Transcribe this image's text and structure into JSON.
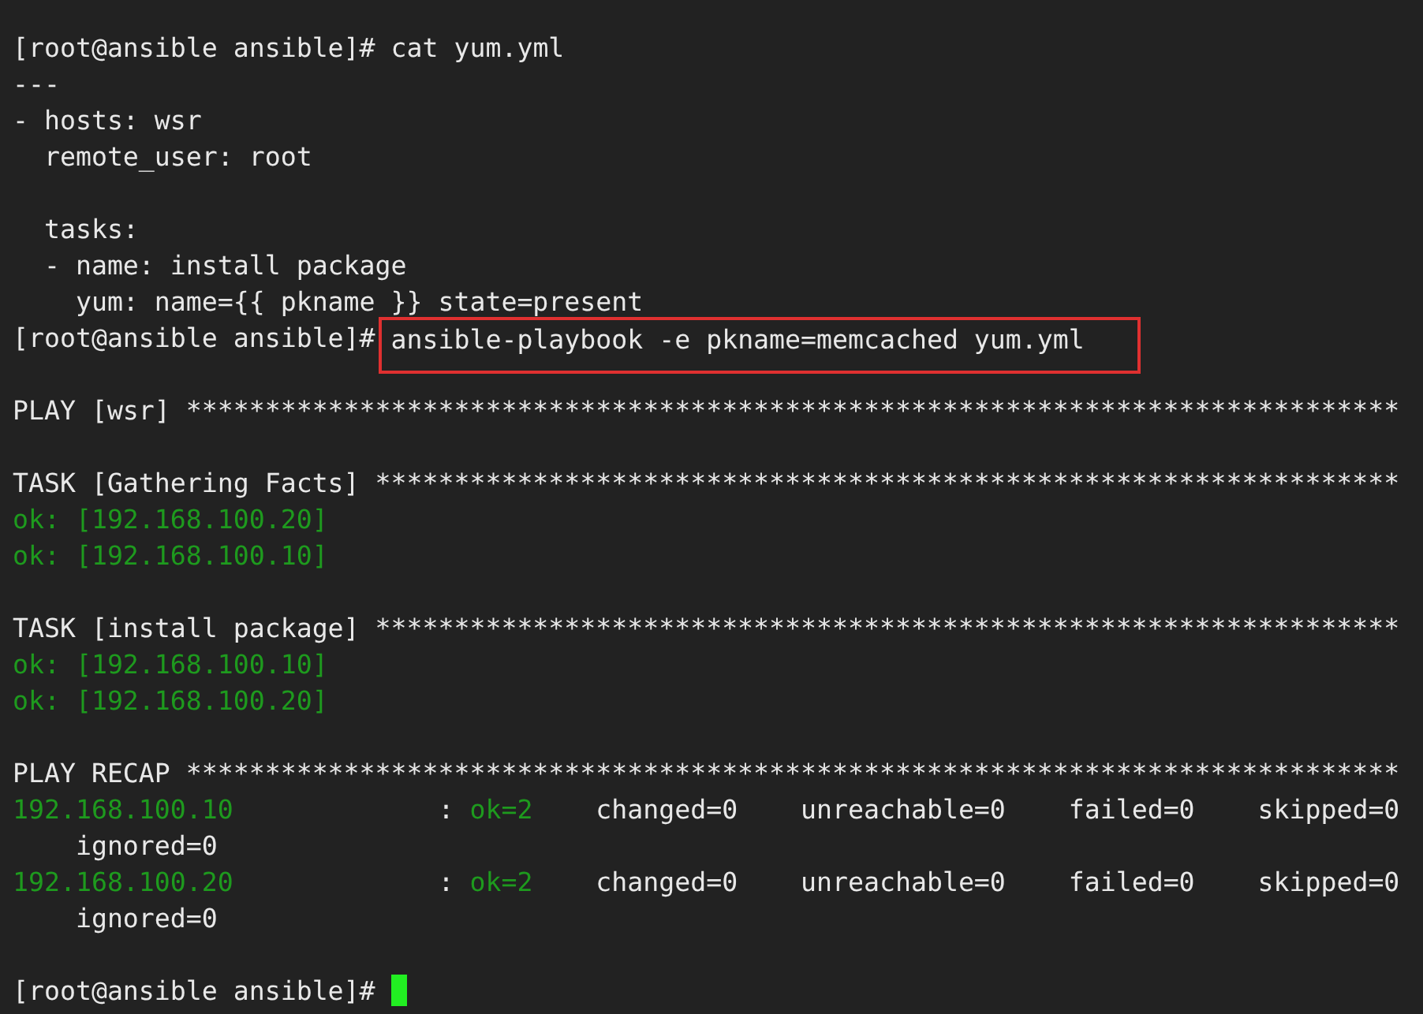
{
  "terminal": {
    "lines": [
      {
        "kind": "text",
        "segments": [
          {
            "kind": "prompt",
            "text": "[root@ansible ansible]# "
          },
          {
            "kind": "command",
            "text": "cat yum.yml",
            "highlighted": false
          }
        ]
      },
      {
        "kind": "text",
        "segments": [
          {
            "kind": "output",
            "text": "---"
          }
        ]
      },
      {
        "kind": "text",
        "segments": [
          {
            "kind": "output",
            "text": "- hosts: wsr"
          }
        ]
      },
      {
        "kind": "text",
        "segments": [
          {
            "kind": "output",
            "text": "  remote_user: root"
          }
        ]
      },
      {
        "kind": "blank"
      },
      {
        "kind": "text",
        "segments": [
          {
            "kind": "output",
            "text": "  tasks:"
          }
        ]
      },
      {
        "kind": "text",
        "segments": [
          {
            "kind": "output",
            "text": "  - name: install package"
          }
        ]
      },
      {
        "kind": "text",
        "segments": [
          {
            "kind": "output",
            "text": "    yum: name={{ pkname }} state=present"
          }
        ]
      },
      {
        "kind": "text",
        "segments": [
          {
            "kind": "prompt",
            "text": "[root@ansible ansible]# "
          },
          {
            "kind": "command",
            "text": "ansible-playbook -e pkname=memcached yum.yml",
            "highlighted": true
          }
        ]
      },
      {
        "kind": "blank"
      },
      {
        "kind": "text",
        "segments": [
          {
            "kind": "output",
            "text": "PLAY [wsr] *****************************************************************************"
          }
        ]
      },
      {
        "kind": "blank"
      },
      {
        "kind": "text",
        "segments": [
          {
            "kind": "output",
            "text": "TASK [Gathering Facts] *****************************************************************"
          }
        ]
      },
      {
        "kind": "text",
        "segments": [
          {
            "kind": "ok",
            "text": "ok: [192.168.100.20]"
          }
        ]
      },
      {
        "kind": "text",
        "segments": [
          {
            "kind": "ok",
            "text": "ok: [192.168.100.10]"
          }
        ]
      },
      {
        "kind": "blank"
      },
      {
        "kind": "text",
        "segments": [
          {
            "kind": "output",
            "text": "TASK [install package] *****************************************************************"
          }
        ]
      },
      {
        "kind": "text",
        "segments": [
          {
            "kind": "ok",
            "text": "ok: [192.168.100.10]"
          }
        ]
      },
      {
        "kind": "text",
        "segments": [
          {
            "kind": "ok",
            "text": "ok: [192.168.100.20]"
          }
        ]
      },
      {
        "kind": "blank"
      },
      {
        "kind": "text",
        "segments": [
          {
            "kind": "output",
            "text": "PLAY RECAP *****************************************************************************"
          }
        ]
      },
      {
        "kind": "text",
        "segments": [
          {
            "kind": "ok",
            "text": "192.168.100.10"
          },
          {
            "kind": "output",
            "text": "             : "
          },
          {
            "kind": "ok",
            "text": "ok=2"
          },
          {
            "kind": "output",
            "text": "    changed=0    unreachable=0    failed=0    skipped=0"
          }
        ]
      },
      {
        "kind": "text",
        "segments": [
          {
            "kind": "output",
            "text": "    ignored=0"
          }
        ]
      },
      {
        "kind": "text",
        "segments": [
          {
            "kind": "ok",
            "text": "192.168.100.20"
          },
          {
            "kind": "output",
            "text": "             : "
          },
          {
            "kind": "ok",
            "text": "ok=2"
          },
          {
            "kind": "output",
            "text": "    changed=0    unreachable=0    failed=0    skipped=0"
          }
        ]
      },
      {
        "kind": "text",
        "segments": [
          {
            "kind": "output",
            "text": "    ignored=0"
          }
        ]
      },
      {
        "kind": "blank"
      },
      {
        "kind": "text",
        "cursor": true,
        "segments": [
          {
            "kind": "prompt",
            "text": "[root@ansible ansible]# "
          }
        ]
      }
    ]
  }
}
